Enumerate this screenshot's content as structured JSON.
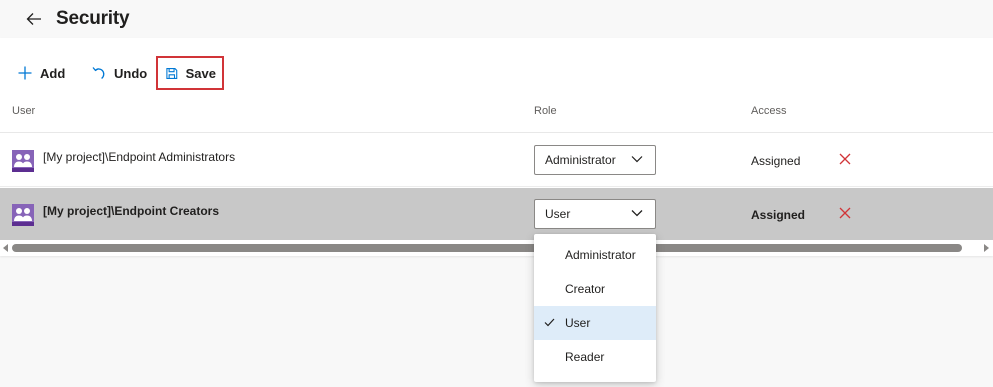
{
  "header": {
    "title": "Security",
    "back_icon": "arrow-left-icon"
  },
  "toolbar": {
    "add_label": "Add",
    "undo_label": "Undo",
    "save_label": "Save",
    "save_highlight_color": "#d13438"
  },
  "table": {
    "columns": {
      "user": "User",
      "role": "Role",
      "access": "Access"
    },
    "rows": [
      {
        "user": "[My project]\\Endpoint Administrators",
        "role": "Administrator",
        "access": "Assigned",
        "selected": false
      },
      {
        "user": "[My project]\\Endpoint Creators",
        "role": "User",
        "access": "Assigned",
        "selected": true
      }
    ]
  },
  "dropdown": {
    "open": true,
    "options": [
      "Administrator",
      "Creator",
      "User",
      "Reader"
    ],
    "selected": "User"
  },
  "colors": {
    "accent": "#0078d4",
    "remove": "#d13438",
    "selected_row": "#c8c8c8",
    "avatar": "#8764b8",
    "selected_option": "#deecf9"
  }
}
